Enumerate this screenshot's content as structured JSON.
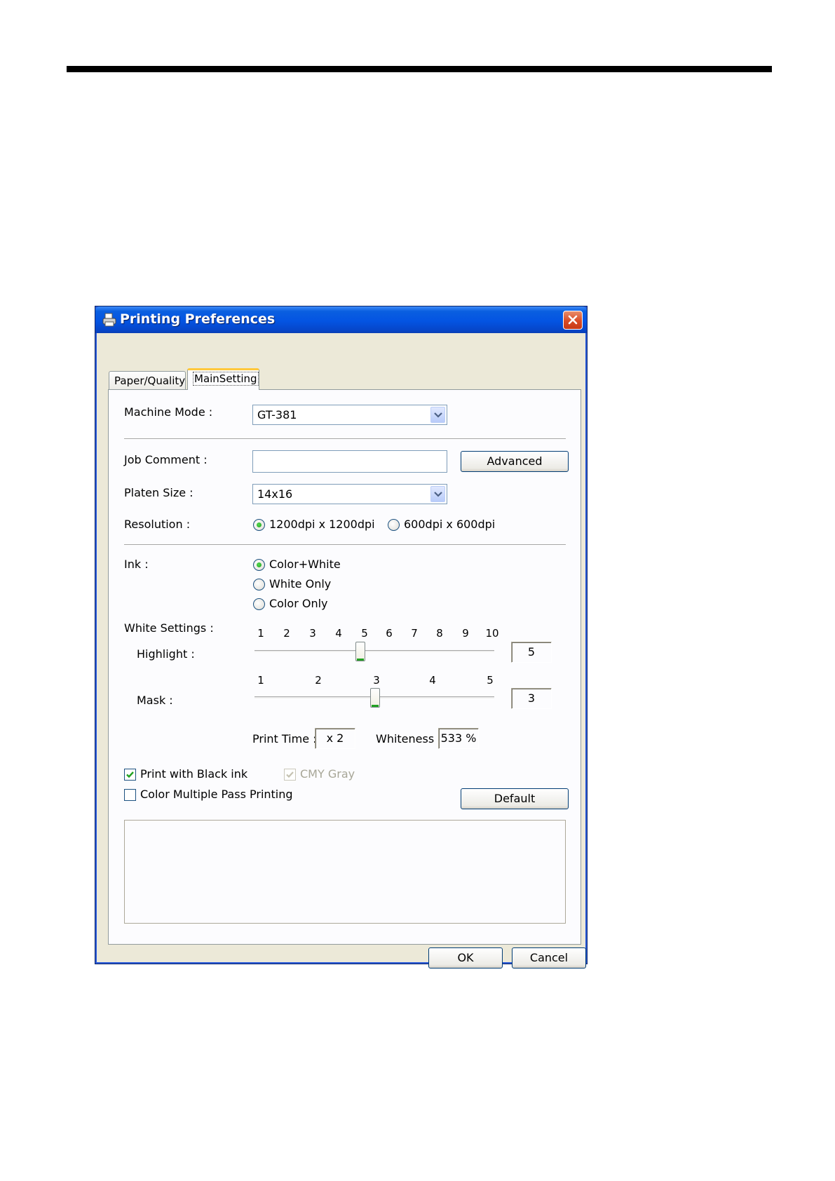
{
  "window": {
    "title": "Printing Preferences"
  },
  "tabs": [
    {
      "label": "Paper/Quality",
      "active": false
    },
    {
      "label": "MainSetting",
      "active": true
    }
  ],
  "machine_mode": {
    "label": "Machine Mode :",
    "value": "GT-381"
  },
  "job_comment": {
    "label": "Job Comment :",
    "value": ""
  },
  "advanced_button": "Advanced",
  "platen_size": {
    "label": "Platen Size :",
    "value": "14x16"
  },
  "resolution": {
    "label": "Resolution :",
    "options": [
      {
        "label": "1200dpi x 1200dpi",
        "checked": true
      },
      {
        "label": "600dpi x 600dpi",
        "checked": false
      }
    ]
  },
  "ink": {
    "label": "Ink :",
    "options": [
      {
        "label": "Color+White",
        "checked": true
      },
      {
        "label": "White Only",
        "checked": false
      },
      {
        "label": "Color Only",
        "checked": false
      }
    ]
  },
  "white_settings": {
    "label": "White Settings :",
    "highlight": {
      "label": "Highlight :",
      "ticks": [
        "1",
        "2",
        "3",
        "4",
        "5",
        "6",
        "7",
        "8",
        "9",
        "10"
      ],
      "value": "5",
      "min": 1,
      "max": 10
    },
    "mask": {
      "label": "Mask :",
      "ticks": [
        "1",
        "2",
        "3",
        "4",
        "5"
      ],
      "value": "3",
      "min": 1,
      "max": 5
    },
    "print_time": {
      "label": "Print Time :",
      "value": "x 2"
    },
    "whiteness": {
      "label": "Whiteness :",
      "value": "533 %"
    }
  },
  "options": {
    "print_black_ink": {
      "label": "Print with Black ink",
      "checked": true
    },
    "cmy_gray": {
      "label": "CMY Gray",
      "checked": true,
      "disabled": true
    },
    "color_multiple_pass": {
      "label": "Color Multiple Pass Printing",
      "checked": false
    }
  },
  "default_button": "Default",
  "ok_button": "OK",
  "cancel_button": "Cancel",
  "colors": {
    "titlebar": "#0454e2",
    "dialog_bg": "#ece9d8",
    "check_green": "#21a121",
    "tab_accent": "#ffc83c"
  }
}
